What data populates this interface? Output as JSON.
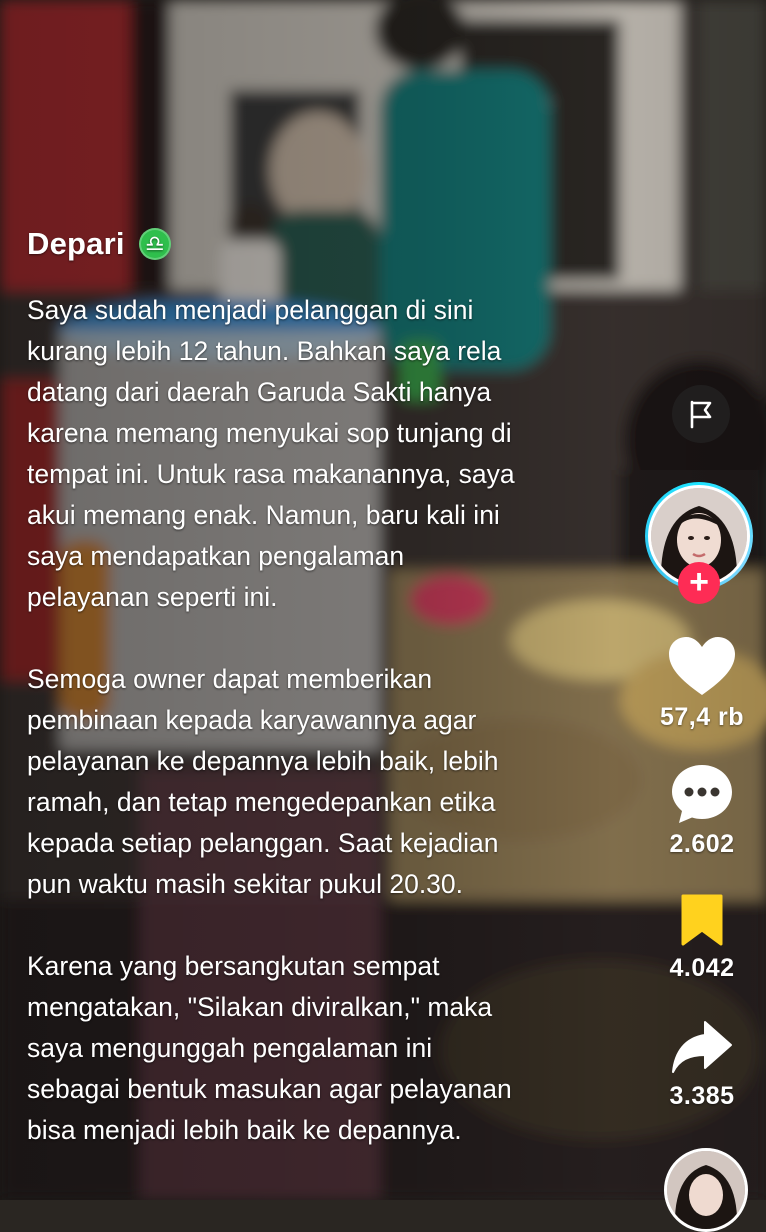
{
  "post": {
    "username": "Depari",
    "zodiac_symbol": "♎",
    "paragraphs": [
      "Saya sudah menjadi pelanggan di sini\nkurang lebih 12 tahun. Bahkan saya rela\ndatang dari daerah Garuda Sakti hanya\nkarena memang menyukai sop tunjang di\ntempat ini. Untuk rasa makanannya, saya\nakui memang enak. Namun, baru kali ini\nsaya mendapatkan pengalaman\npelayanan seperti ini.",
      "Semoga owner dapat memberikan\npembinaan kepada karyawannya agar\npelayanan ke depannya lebih baik, lebih\nramah, dan tetap mengedepankan etika\nkepada setiap pelanggan. Saat kejadian\npun waktu masih sekitar pukul 20.30.",
      "Karena yang bersangkutan sempat\nmengatakan, \"Silakan diviralkan,\" maka\nsaya mengunggah pengalaman ini\nsebagai bentuk masukan agar pelayanan\nbisa menjadi lebih baik ke depannya."
    ]
  },
  "actions": {
    "follow_symbol": "+",
    "likes": "57,4 rb",
    "comments": "2.602",
    "bookmarks": "4.042",
    "shares": "3.385"
  },
  "icons": {
    "report": "flag-icon",
    "like": "heart-icon",
    "comment": "speech-bubble-icon",
    "bookmark": "bookmark-icon",
    "share": "share-arrow-icon"
  },
  "colors": {
    "follow_badge": "#fe2c55",
    "bookmark_active": "#ffd21e",
    "zodiac_badge": "#2fbf4c",
    "avatar_ring": "#1ee3ff"
  }
}
